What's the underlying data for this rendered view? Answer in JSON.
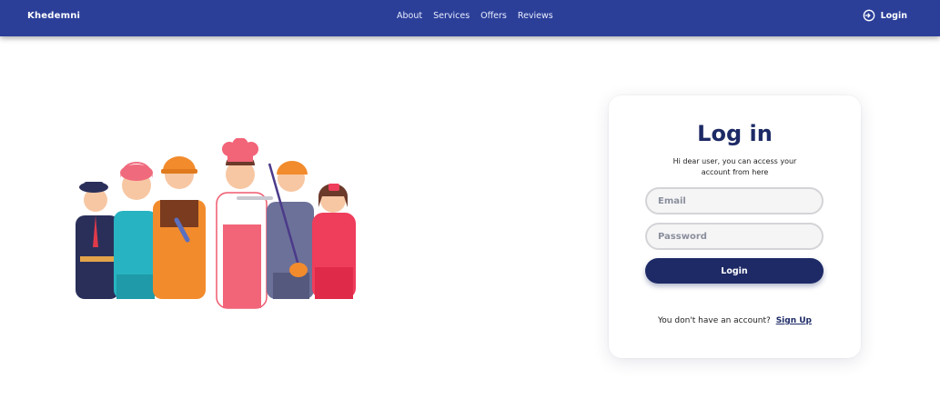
{
  "header": {
    "brand": "Khedemni",
    "nav": [
      "About",
      "Services",
      "Offers",
      "Reviews"
    ],
    "login_label": "Login"
  },
  "login_card": {
    "title": "Log in",
    "subtitle": "Hi dear user, you can access your account from here",
    "email_placeholder": "Email",
    "password_placeholder": "Password",
    "submit_label": "Login",
    "signup_prompt": "You don't have an account?",
    "signup_link": "Sign Up"
  },
  "colors": {
    "navbar": "#2b3f99",
    "primary": "#1d2a66",
    "input_bg": "#f5f5f6"
  },
  "illustration": {
    "icon": "workers-group-illustration"
  }
}
